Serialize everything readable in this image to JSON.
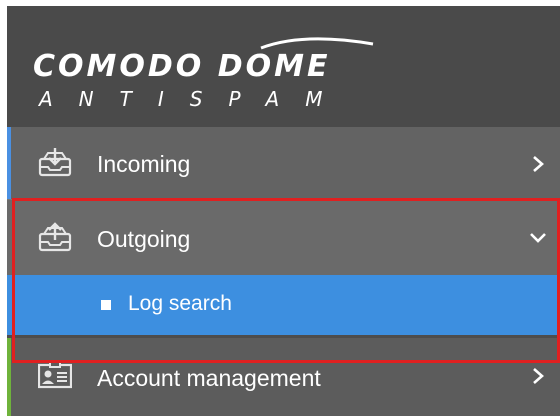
{
  "logo": {
    "line1": "COMODO DOME",
    "line2": "ANTISPAM"
  },
  "nav": {
    "incoming": {
      "label": "Incoming",
      "icon": "inbox-download-icon",
      "expanded": false
    },
    "outgoing": {
      "label": "Outgoing",
      "icon": "outbox-upload-icon",
      "expanded": true
    },
    "outgoing_sub": {
      "label": "Log search",
      "selected": true
    },
    "account": {
      "label": "Account management",
      "icon": "id-card-icon",
      "expanded": false
    }
  },
  "colors": {
    "sidebar_bg": "#5f5f5f",
    "logo_bg": "#4a4a4a",
    "selected_bg": "#3d8fe0",
    "highlight_border": "#e02020",
    "incoming_accent": "#4a90e2",
    "account_accent": "#6fb33b"
  }
}
